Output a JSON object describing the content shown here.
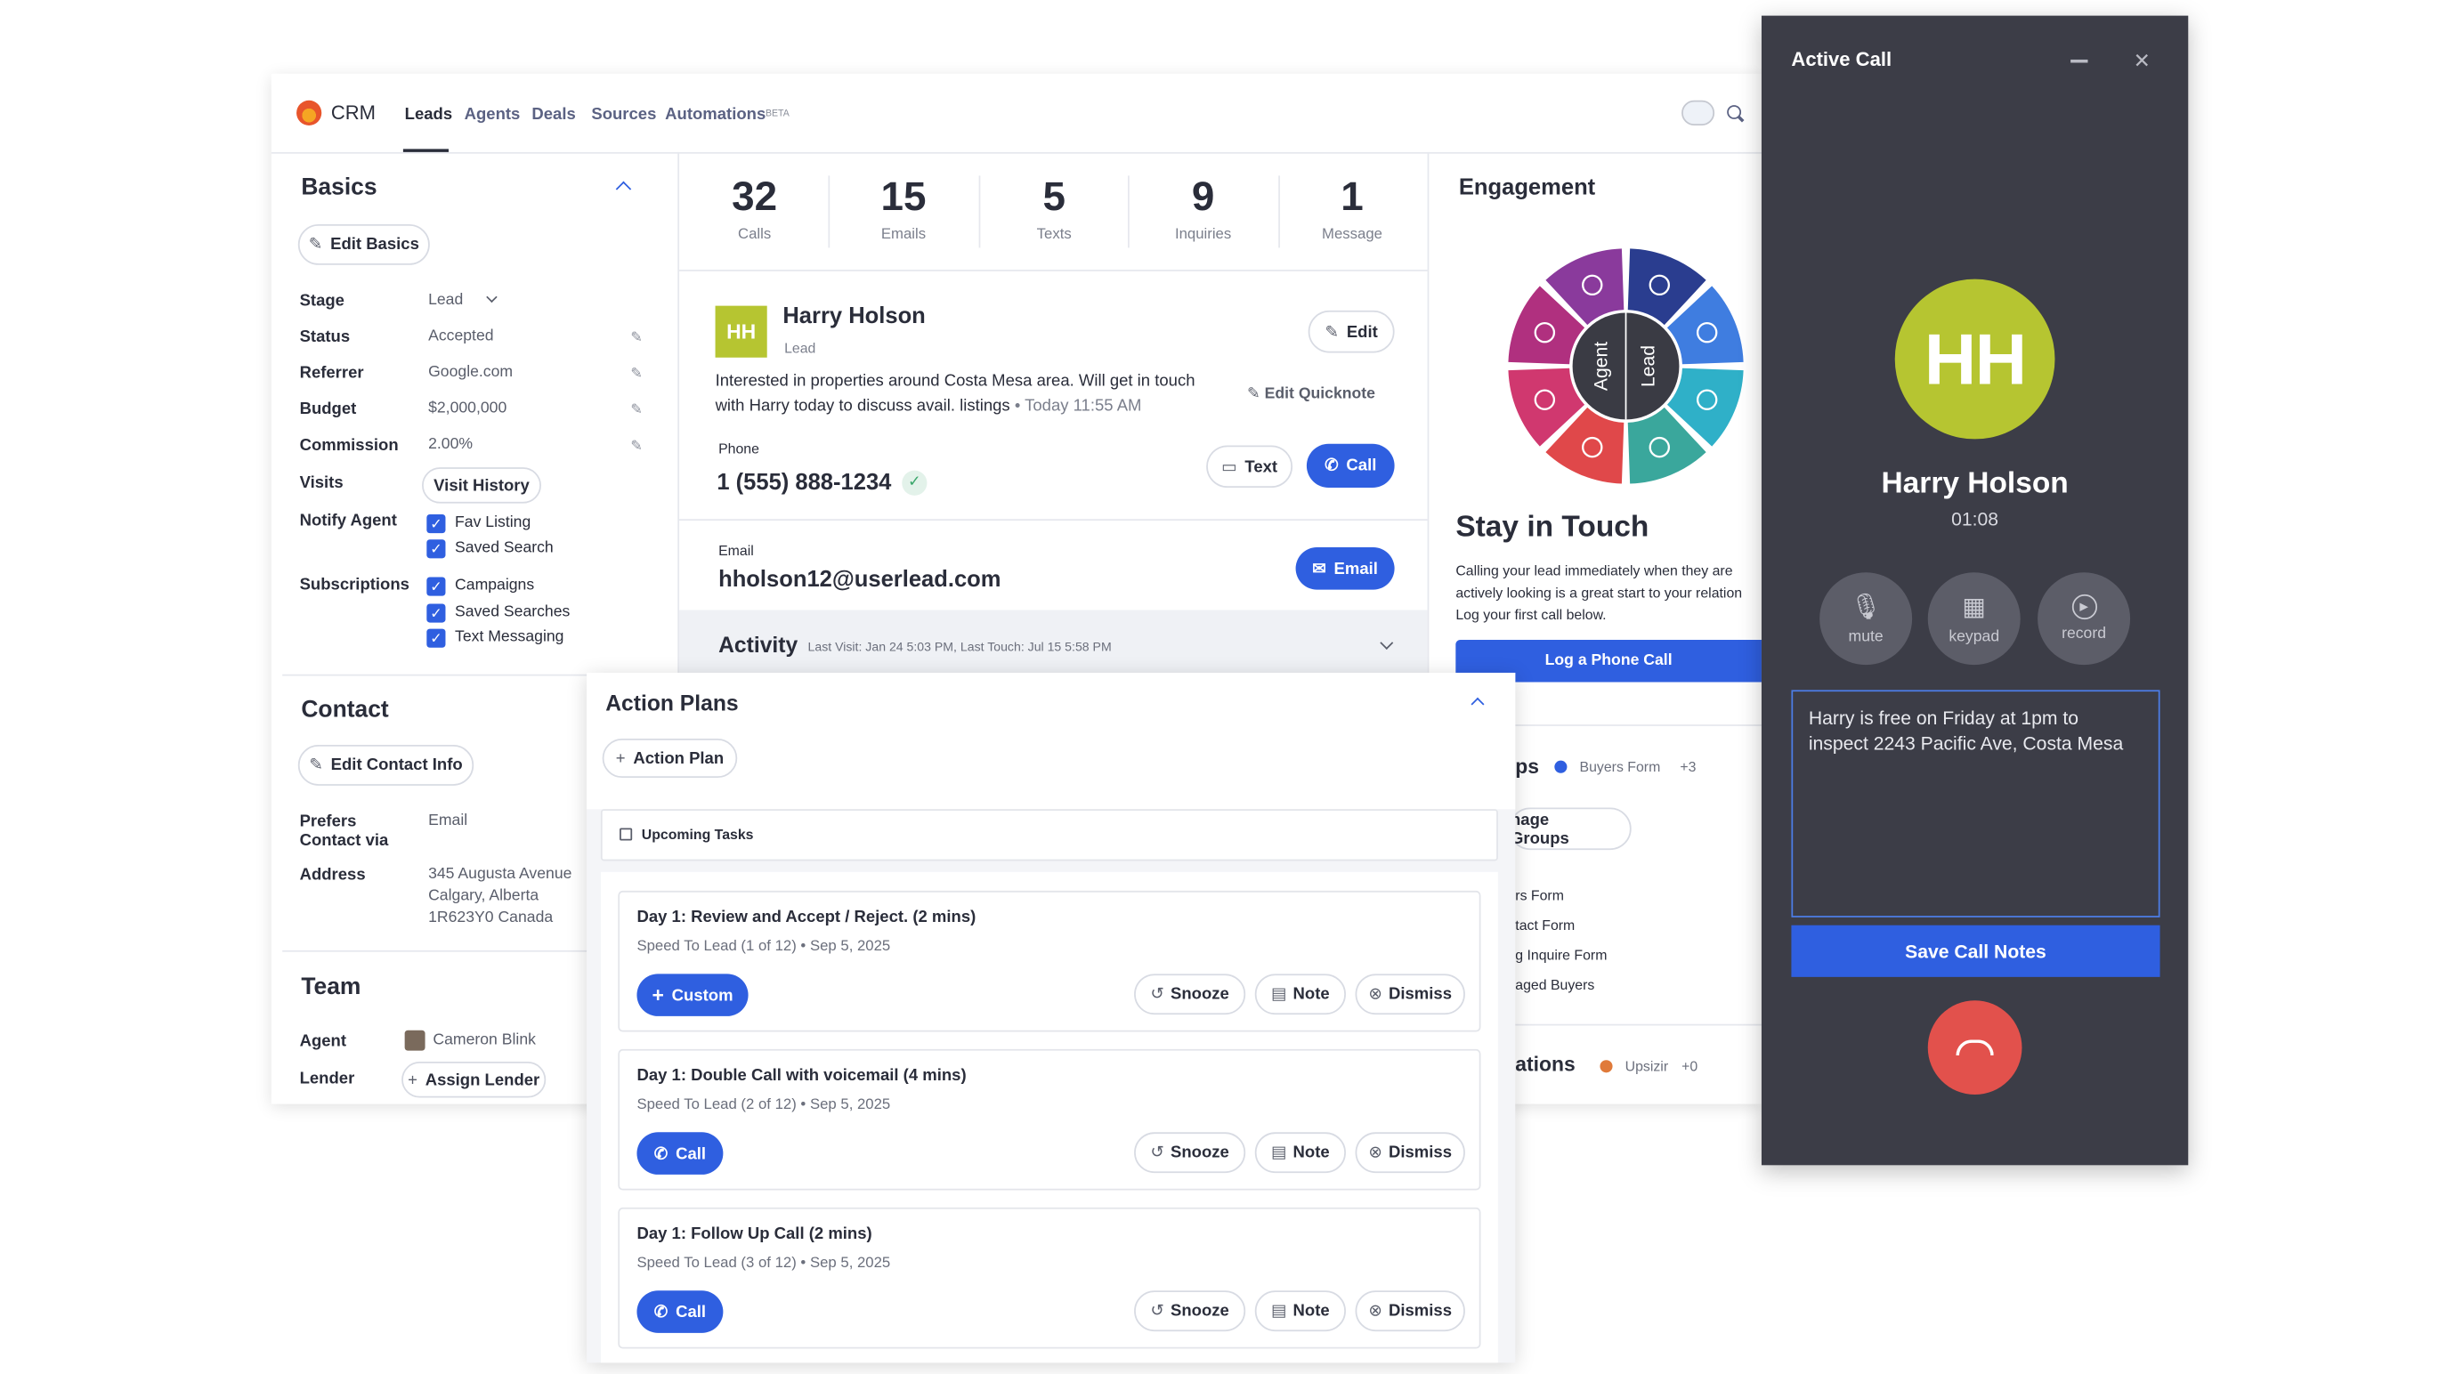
{
  "nav": {
    "brand": "CRM",
    "tabs": [
      "Leads",
      "Agents",
      "Deals",
      "Sources",
      "Automations"
    ],
    "beta": "BETA"
  },
  "basics": {
    "title": "Basics",
    "edit": "Edit Basics",
    "fields": [
      {
        "label": "Stage",
        "value": "Lead"
      },
      {
        "label": "Status",
        "value": "Accepted"
      },
      {
        "label": "Referrer",
        "value": "Google.com"
      },
      {
        "label": "Budget",
        "value": "$2,000,000"
      },
      {
        "label": "Commission",
        "value": "2.00%"
      }
    ],
    "visits_label": "Visits",
    "visit_history": "Visit History",
    "notify_label": "Notify Agent",
    "notify": [
      "Fav Listing",
      "Saved Search"
    ],
    "subs_label": "Subscriptions",
    "subs": [
      "Campaigns",
      "Saved Searches",
      "Text Messaging"
    ]
  },
  "contact": {
    "title": "Contact",
    "edit": "Edit Contact Info",
    "prefers_label": "Prefers Contact via",
    "prefers_value": "Email",
    "address_label": "Address",
    "address": [
      "345 Augusta Avenue",
      "Calgary, Alberta",
      "1R623Y0 Canada"
    ]
  },
  "team": {
    "title": "Team",
    "agent_label": "Agent",
    "agent": "Cameron Blink",
    "lender_label": "Lender",
    "assign": "Assign Lender"
  },
  "stats": [
    {
      "n": "32",
      "t": "Calls"
    },
    {
      "n": "15",
      "t": "Emails"
    },
    {
      "n": "5",
      "t": "Texts"
    },
    {
      "n": "9",
      "t": "Inquiries"
    },
    {
      "n": "1",
      "t": "Message"
    }
  ],
  "lead": {
    "initials": "HH",
    "name": "Harry Holson",
    "role": "Lead",
    "edit": "Edit",
    "note1": "Interested in properties around Costa Mesa area. Will get in touch",
    "note2": "with Harry today to discuss avail. listings",
    "note_time": "• Today 11:55 AM",
    "edit_quicknote": "Edit Quicknote",
    "phone_label": "Phone",
    "phone": "1 (555) 888-1234",
    "text_btn": "Text",
    "call_btn": "Call",
    "email_label": "Email",
    "email": "hholson12@userlead.com",
    "email_btn": "Email"
  },
  "activity": {
    "title": "Activity",
    "meta": "Last Visit: Jan 24 5:03 PM, Last Touch: Jul 15 5:58 PM"
  },
  "engagement": {
    "title": "Engagement",
    "agent": "Agent",
    "lead": "Lead",
    "stay": "Stay in Touch",
    "desc": [
      "Calling your lead immediately when they are",
      "actively looking is a great start to your relation",
      "Log your first call below."
    ],
    "log_btn": "Log a Phone Call",
    "groups_frag": "ps",
    "groups_tag": "Buyers Form",
    "groups_more": "+3",
    "manage": "nage Groups",
    "list": [
      "rs Form",
      "tact Form",
      "g Inquire Form",
      "aged Buyers"
    ],
    "integ_frag": "ations",
    "integ_tag": "Upsizir",
    "integ_more": "+0",
    "colors": {
      "purple": "#8a3a9c",
      "navy": "#2a3d8f",
      "blue": "#3f7de0",
      "teal": "#2fb0c8",
      "green": "#3aa79c",
      "red": "#e0484a",
      "pink": "#d0386f",
      "magenta": "#b0307f"
    }
  },
  "plans": {
    "title": "Action Plans",
    "add": "Action Plan",
    "upcoming": "Upcoming Tasks",
    "tasks": [
      {
        "title": "Day 1: Review and Accept / Reject. (2 mins)",
        "sub": "Speed To Lead (1 of 12) • Sep 5, 2025",
        "btn": "Custom"
      },
      {
        "title": "Day 1: Double Call with voicemail (4 mins)",
        "sub": "Speed To Lead (2 of 12) • Sep 5, 2025",
        "btn": "Call"
      },
      {
        "title": "Day 1: Follow Up Call (2 mins)",
        "sub": "Speed To Lead (3 of 12) • Sep 5, 2025",
        "btn": "Call"
      }
    ],
    "snooze": "Snooze",
    "note": "Note",
    "dismiss": "Dismiss"
  },
  "call": {
    "title": "Active Call",
    "initials": "HH",
    "name": "Harry Holson",
    "time": "01:08",
    "mute": "mute",
    "keypad": "keypad",
    "record": "record",
    "notes": "Harry is free on Friday at 1pm to inspect 2243 Pacific Ave, Costa Mesa",
    "save": "Save Call Notes",
    "avatar_color": "#b6c531",
    "hangup_color": "#e2514c",
    "bg": "#3c3d47"
  }
}
